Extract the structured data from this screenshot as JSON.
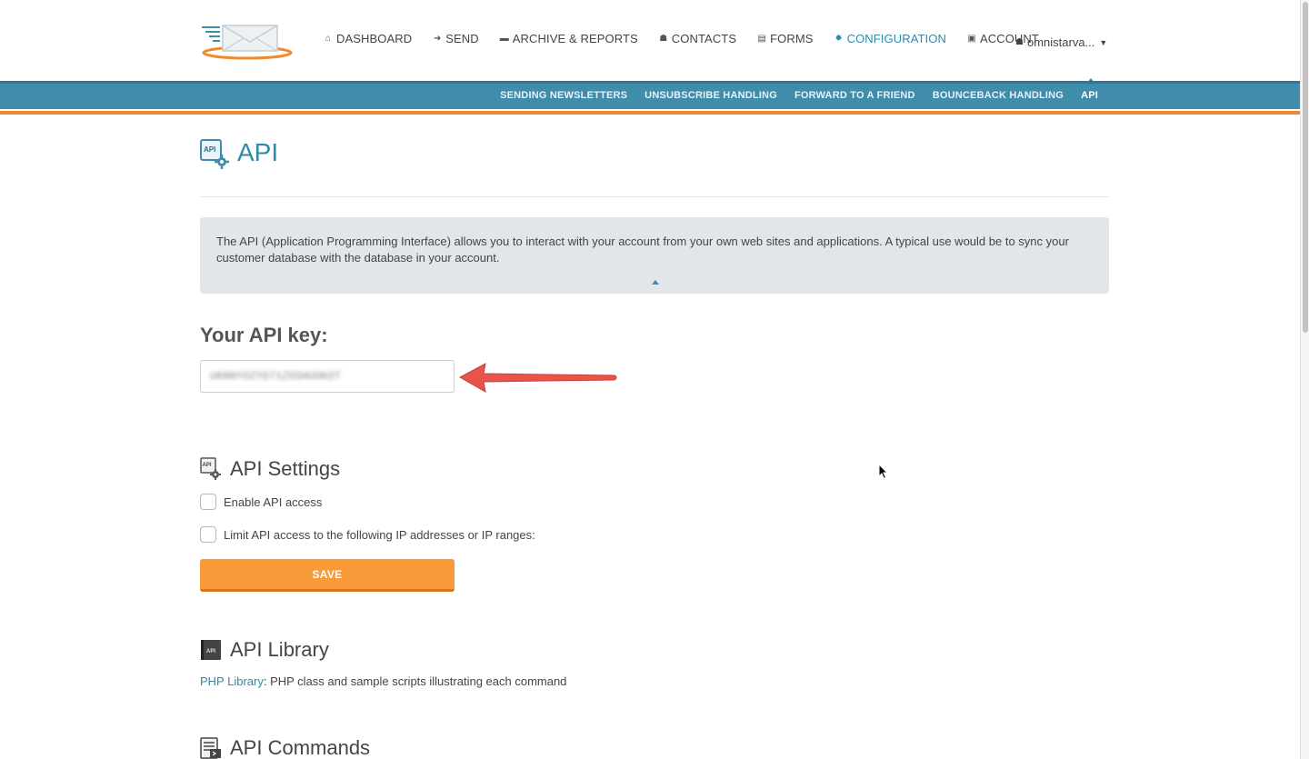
{
  "header": {
    "nav": [
      {
        "icon": "home-icon",
        "glyph": "⌂",
        "label": "DASHBOARD",
        "active": false
      },
      {
        "icon": "send-arrow-icon",
        "glyph": "➜",
        "label": "SEND",
        "active": false
      },
      {
        "icon": "folder-icon",
        "glyph": "▬",
        "label": "ARCHIVE & REPORTS",
        "active": false
      },
      {
        "icon": "person-icon",
        "glyph": "☗",
        "label": "CONTACTS",
        "active": false
      },
      {
        "icon": "form-icon",
        "glyph": "▤",
        "label": "FORMS",
        "active": false
      },
      {
        "icon": "gear-icon",
        "glyph": "✹",
        "label": "CONFIGURATION",
        "active": true
      },
      {
        "icon": "account-icon",
        "glyph": "▣",
        "label": "ACCOUNT",
        "active": false
      }
    ],
    "user": {
      "icon": "user-icon",
      "glyph": "☗",
      "name": "omnistarva...",
      "caret": "▼"
    }
  },
  "subnav": [
    {
      "label": "SENDING NEWSLETTERS",
      "active": false
    },
    {
      "label": "UNSUBSCRIBE HANDLING",
      "active": false
    },
    {
      "label": "FORWARD TO A FRIEND",
      "active": false
    },
    {
      "label": "BOUNCEBACK HANDLING",
      "active": false
    },
    {
      "label": "API",
      "active": true
    }
  ],
  "page": {
    "title": "API",
    "info": "The API (Application Programming Interface) allows you to interact with your account from your own web sites and applications. A typical use would be to sync your customer database with the database in your account."
  },
  "apikey": {
    "label": "Your API key:",
    "value": "UKNNYOZYD71ZOSHUOKOT"
  },
  "settings": {
    "title": "API Settings",
    "enable_label": "Enable API access",
    "limit_label": "Limit API access to the following IP addresses or IP ranges:",
    "save_label": "SAVE"
  },
  "library": {
    "title": "API Library",
    "link_label": "PHP Library",
    "description": ": PHP class and sample scripts illustrating each command"
  },
  "commands": {
    "title": "API Commands"
  },
  "colors": {
    "accent_blue": "#3f8cab",
    "accent_orange": "#f0892a",
    "save_button": "#f99a38",
    "arrow_red": "#e9534a"
  }
}
